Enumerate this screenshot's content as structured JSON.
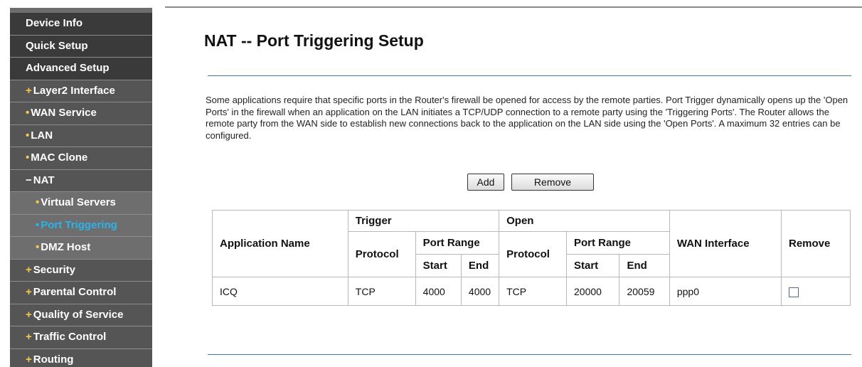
{
  "sidebar": {
    "items": [
      {
        "label": "Device Info",
        "level": "top",
        "bullet": ""
      },
      {
        "label": "Quick Setup",
        "level": "top",
        "bullet": ""
      },
      {
        "label": "Advanced Setup",
        "level": "top",
        "bullet": ""
      },
      {
        "label": "Layer2 Interface",
        "level": "sub",
        "bullet": "+"
      },
      {
        "label": "WAN Service",
        "level": "sub",
        "bullet": "•"
      },
      {
        "label": "LAN",
        "level": "sub",
        "bullet": "•"
      },
      {
        "label": "MAC Clone",
        "level": "sub",
        "bullet": "•"
      },
      {
        "label": "NAT",
        "level": "sub",
        "bullet": "−"
      },
      {
        "label": "Virtual Servers",
        "level": "subsub",
        "bullet": "•"
      },
      {
        "label": "Port Triggering",
        "level": "subsub",
        "bullet": "•",
        "active": true
      },
      {
        "label": "DMZ Host",
        "level": "subsub",
        "bullet": "•"
      },
      {
        "label": "Security",
        "level": "sub",
        "bullet": "+"
      },
      {
        "label": "Parental Control",
        "level": "sub",
        "bullet": "+"
      },
      {
        "label": "Quality of Service",
        "level": "sub",
        "bullet": "+"
      },
      {
        "label": "Traffic Control",
        "level": "sub",
        "bullet": "+"
      },
      {
        "label": "Routing",
        "level": "sub",
        "bullet": "+"
      }
    ]
  },
  "main": {
    "title": "NAT -- Port Triggering Setup",
    "description": "Some applications require that specific ports in the Router's firewall be opened for access by the remote parties. Port Trigger dynamically opens up the 'Open Ports' in the firewall when an application on the LAN initiates a TCP/UDP connection to a remote party using the 'Triggering Ports'. The Router allows the remote party from the WAN side to establish new connections back to the application on the LAN side using the 'Open Ports'. A maximum 32 entries can be configured.",
    "buttons": {
      "add": "Add",
      "remove": "Remove"
    },
    "table": {
      "headers": {
        "application_name": "Application Name",
        "trigger": "Trigger",
        "open": "Open",
        "trigger_protocol": "Protocol",
        "trigger_port_range": "Port Range",
        "trigger_start": "Start",
        "trigger_end": "End",
        "open_protocol": "Protocol",
        "open_port_range": "Port Range",
        "open_start": "Start",
        "open_end": "End",
        "wan_interface": "WAN Interface",
        "remove": "Remove"
      },
      "rows": [
        {
          "application_name": "ICQ",
          "trigger_protocol": "TCP",
          "trigger_start": "4000",
          "trigger_end": "4000",
          "open_protocol": "TCP",
          "open_start": "20000",
          "open_end": "20059",
          "wan_interface": "ppp0",
          "remove_checked": false
        }
      ]
    }
  }
}
